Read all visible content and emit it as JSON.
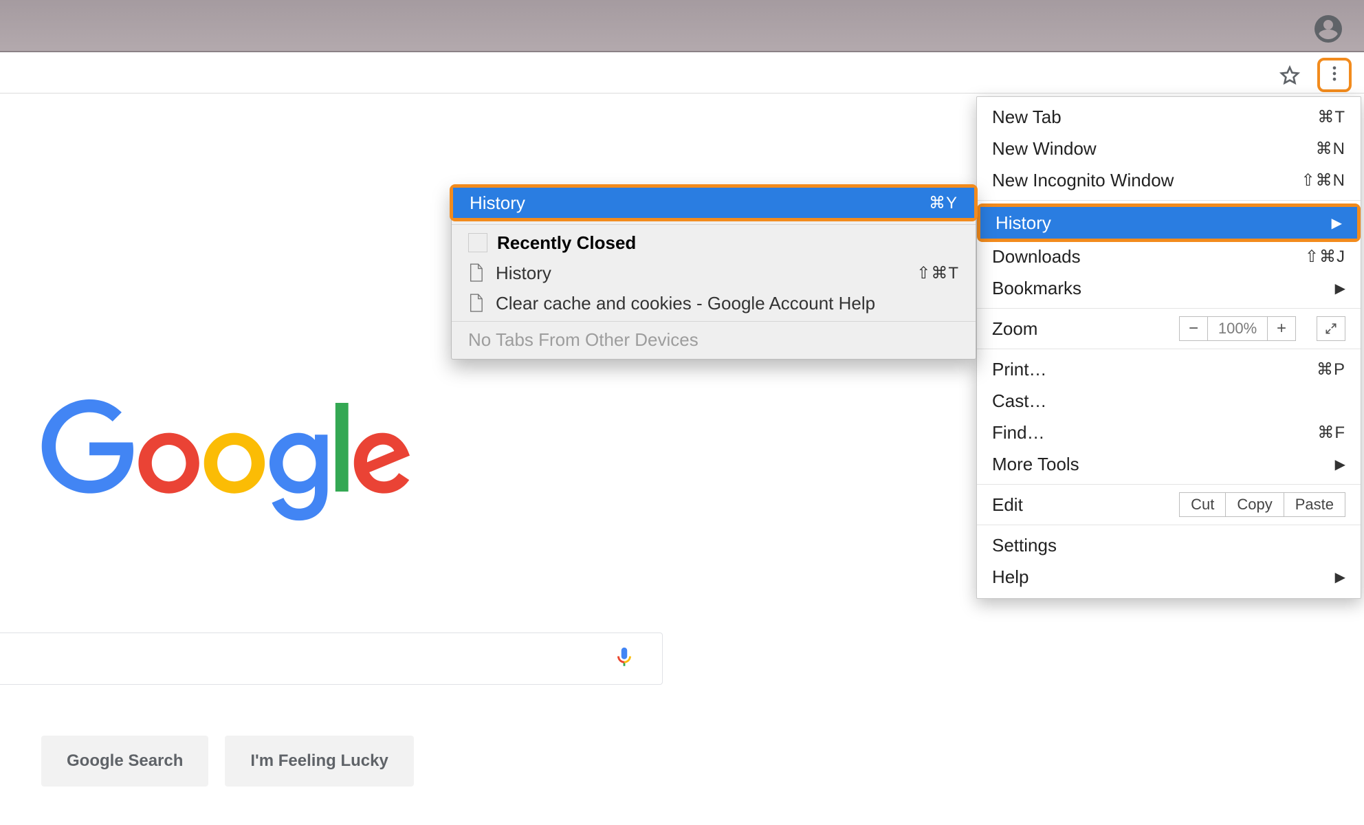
{
  "titlebar": {
    "profile_name": "profile"
  },
  "toolbar": {
    "star_label": "bookmark",
    "menu_label": "customize and control"
  },
  "google": {
    "search_button": "Google Search",
    "lucky_button": "I'm Feeling Lucky"
  },
  "main_menu": {
    "new_tab": {
      "label": "New Tab",
      "accel": "⌘T"
    },
    "new_window": {
      "label": "New Window",
      "accel": "⌘N"
    },
    "new_incognito": {
      "label": "New Incognito Window",
      "accel": "⇧⌘N"
    },
    "history": {
      "label": "History"
    },
    "downloads": {
      "label": "Downloads",
      "accel": "⇧⌘J"
    },
    "bookmarks": {
      "label": "Bookmarks"
    },
    "zoom": {
      "label": "Zoom",
      "value": "100%"
    },
    "print": {
      "label": "Print…",
      "accel": "⌘P"
    },
    "cast": {
      "label": "Cast…"
    },
    "find": {
      "label": "Find…",
      "accel": "⌘F"
    },
    "more_tools": {
      "label": "More Tools"
    },
    "edit": {
      "label": "Edit",
      "cut": "Cut",
      "copy": "Copy",
      "paste": "Paste"
    },
    "settings": {
      "label": "Settings"
    },
    "help": {
      "label": "Help"
    }
  },
  "sub_menu": {
    "history": {
      "label": "History",
      "accel": "⌘Y"
    },
    "recently_closed": "Recently Closed",
    "items": [
      {
        "label": "History",
        "accel": "⇧⌘T"
      },
      {
        "label": "Clear cache and cookies - Google Account Help",
        "accel": ""
      }
    ],
    "no_tabs": "No Tabs From Other Devices"
  }
}
